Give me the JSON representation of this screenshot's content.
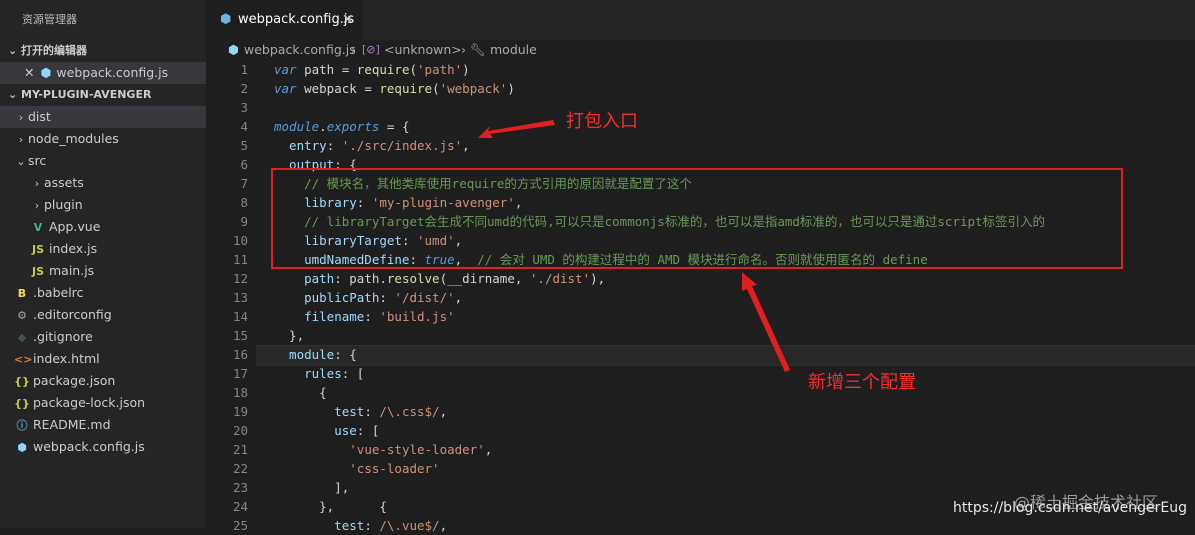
{
  "explorer": {
    "title": "资源管理器",
    "open_editors_label": "打开的编辑器",
    "open_editor_file": "webpack.config.js",
    "project_label": "MY-PLUGIN-AVENGER",
    "tree": [
      {
        "label": "dist",
        "indent": 0,
        "chevron": "›",
        "icon": "",
        "icon_color": "",
        "active": true
      },
      {
        "label": "node_modules",
        "indent": 0,
        "chevron": "›",
        "icon": "",
        "icon_color": ""
      },
      {
        "label": "src",
        "indent": 0,
        "chevron": "⌄",
        "icon": "",
        "icon_color": ""
      },
      {
        "label": "assets",
        "indent": 1,
        "chevron": "›",
        "icon": "",
        "icon_color": ""
      },
      {
        "label": "plugin",
        "indent": 1,
        "chevron": "›",
        "icon": "",
        "icon_color": ""
      },
      {
        "label": "App.vue",
        "indent": 1,
        "chevron": "",
        "icon": "V",
        "icon_color": "#41b883"
      },
      {
        "label": "index.js",
        "indent": 1,
        "chevron": "",
        "icon": "JS",
        "icon_color": "#cbcb41"
      },
      {
        "label": "main.js",
        "indent": 1,
        "chevron": "",
        "icon": "JS",
        "icon_color": "#cbcb41"
      },
      {
        "label": ".babelrc",
        "indent": 0,
        "chevron": "",
        "icon": "B",
        "icon_color": "#f5da55"
      },
      {
        "label": ".editorconfig",
        "indent": 0,
        "chevron": "",
        "icon": "⚙",
        "icon_color": "#9da5b4"
      },
      {
        "label": ".gitignore",
        "indent": 0,
        "chevron": "",
        "icon": "◆",
        "icon_color": "#41535b"
      },
      {
        "label": "index.html",
        "indent": 0,
        "chevron": "",
        "icon": "<>",
        "icon_color": "#e37933"
      },
      {
        "label": "package.json",
        "indent": 0,
        "chevron": "",
        "icon": "{}",
        "icon_color": "#cbcb41"
      },
      {
        "label": "package-lock.json",
        "indent": 0,
        "chevron": "",
        "icon": "{}",
        "icon_color": "#cbcb41"
      },
      {
        "label": "README.md",
        "indent": 0,
        "chevron": "",
        "icon": "ⓘ",
        "icon_color": "#519aba"
      },
      {
        "label": "webpack.config.js",
        "indent": 0,
        "chevron": "",
        "icon": "⬢",
        "icon_color": "#8dd6f9"
      }
    ]
  },
  "tab": {
    "label": "webpack.config.js",
    "close": "✕"
  },
  "breadcrumb": {
    "file": "webpack.config.js",
    "separator": "›",
    "unknown": "<unknown>",
    "module": "module"
  },
  "lines": [
    [
      {
        "t": "var",
        "c": "k"
      },
      {
        "t": " path "
      },
      {
        "t": "="
      },
      {
        "t": " "
      },
      {
        "t": "require",
        "c": "f"
      },
      {
        "t": "("
      },
      {
        "t": "'path'",
        "c": "s"
      },
      {
        "t": ")"
      }
    ],
    [
      {
        "t": "var",
        "c": "k"
      },
      {
        "t": " webpack "
      },
      {
        "t": "="
      },
      {
        "t": " "
      },
      {
        "t": "require",
        "c": "f"
      },
      {
        "t": "("
      },
      {
        "t": "'webpack'",
        "c": "s"
      },
      {
        "t": ")"
      }
    ],
    [],
    [
      {
        "t": "module",
        "c": "k"
      },
      {
        "t": "."
      },
      {
        "t": "exports",
        "c": "k"
      },
      {
        "t": " = {"
      }
    ],
    [
      {
        "t": "  entry",
        "c": "p"
      },
      {
        "t": ": "
      },
      {
        "t": "'./src/index.js'",
        "c": "s"
      },
      {
        "t": ","
      }
    ],
    [
      {
        "t": "  output",
        "c": "p"
      },
      {
        "t": ": {"
      }
    ],
    [
      {
        "t": "    // 模块名，其他类库使用require的方式引用的原因就是配置了这个",
        "c": "c"
      }
    ],
    [
      {
        "t": "    library",
        "c": "p"
      },
      {
        "t": ": "
      },
      {
        "t": "'my-plugin-avenger'",
        "c": "s"
      },
      {
        "t": ","
      }
    ],
    [
      {
        "t": "    // libraryTarget会生成不同umd的代码,可以只是commonjs标准的，也可以是指amd标准的，也可以只是通过script标签引入的",
        "c": "c"
      }
    ],
    [
      {
        "t": "    libraryTarget",
        "c": "p"
      },
      {
        "t": ": "
      },
      {
        "t": "'umd'",
        "c": "s"
      },
      {
        "t": ","
      }
    ],
    [
      {
        "t": "    umdNamedDefine",
        "c": "p"
      },
      {
        "t": ": "
      },
      {
        "t": "true",
        "c": "k"
      },
      {
        "t": ",  "
      },
      {
        "t": "// 会对 UMD 的构建过程中的 AMD 模块进行命名。否则就使用匿名的 define",
        "c": "c"
      }
    ],
    [
      {
        "t": "    path",
        "c": "p"
      },
      {
        "t": ": path."
      },
      {
        "t": "resolve",
        "c": "f"
      },
      {
        "t": "(__dirname, "
      },
      {
        "t": "'./dist'",
        "c": "s"
      },
      {
        "t": "),"
      }
    ],
    [
      {
        "t": "    publicPath",
        "c": "p"
      },
      {
        "t": ": "
      },
      {
        "t": "'/dist/'",
        "c": "s"
      },
      {
        "t": ","
      }
    ],
    [
      {
        "t": "    filename",
        "c": "p"
      },
      {
        "t": ": "
      },
      {
        "t": "'build.js'",
        "c": "s"
      }
    ],
    [
      {
        "t": "  },"
      }
    ],
    [
      {
        "t": "  module",
        "c": "p"
      },
      {
        "t": ": {"
      }
    ],
    [
      {
        "t": "    rules",
        "c": "p"
      },
      {
        "t": ": ["
      }
    ],
    [
      {
        "t": "      {"
      }
    ],
    [
      {
        "t": "        test",
        "c": "p"
      },
      {
        "t": ": "
      },
      {
        "t": "/\\.css$/",
        "c": "s"
      },
      {
        "t": ","
      }
    ],
    [
      {
        "t": "        use",
        "c": "p"
      },
      {
        "t": ": ["
      }
    ],
    [
      {
        "t": "          "
      },
      {
        "t": "'vue-style-loader'",
        "c": "s"
      },
      {
        "t": ","
      }
    ],
    [
      {
        "t": "          "
      },
      {
        "t": "'css-loader'",
        "c": "s"
      }
    ],
    [
      {
        "t": "        ],"
      }
    ],
    [
      {
        "t": "      },      {"
      }
    ],
    [
      {
        "t": "        test",
        "c": "p"
      },
      {
        "t": ": "
      },
      {
        "t": "/\\.vue$/",
        "c": "s"
      },
      {
        "t": ","
      }
    ]
  ],
  "annotations": {
    "entry_label": "打包入口",
    "new_config_label": "新增三个配置"
  },
  "watermark": {
    "community": "@稀土掘金技术社区",
    "url": "https://blog.csdn.net/avengerEug"
  },
  "colors": {
    "annotation_red": "#e02020"
  }
}
